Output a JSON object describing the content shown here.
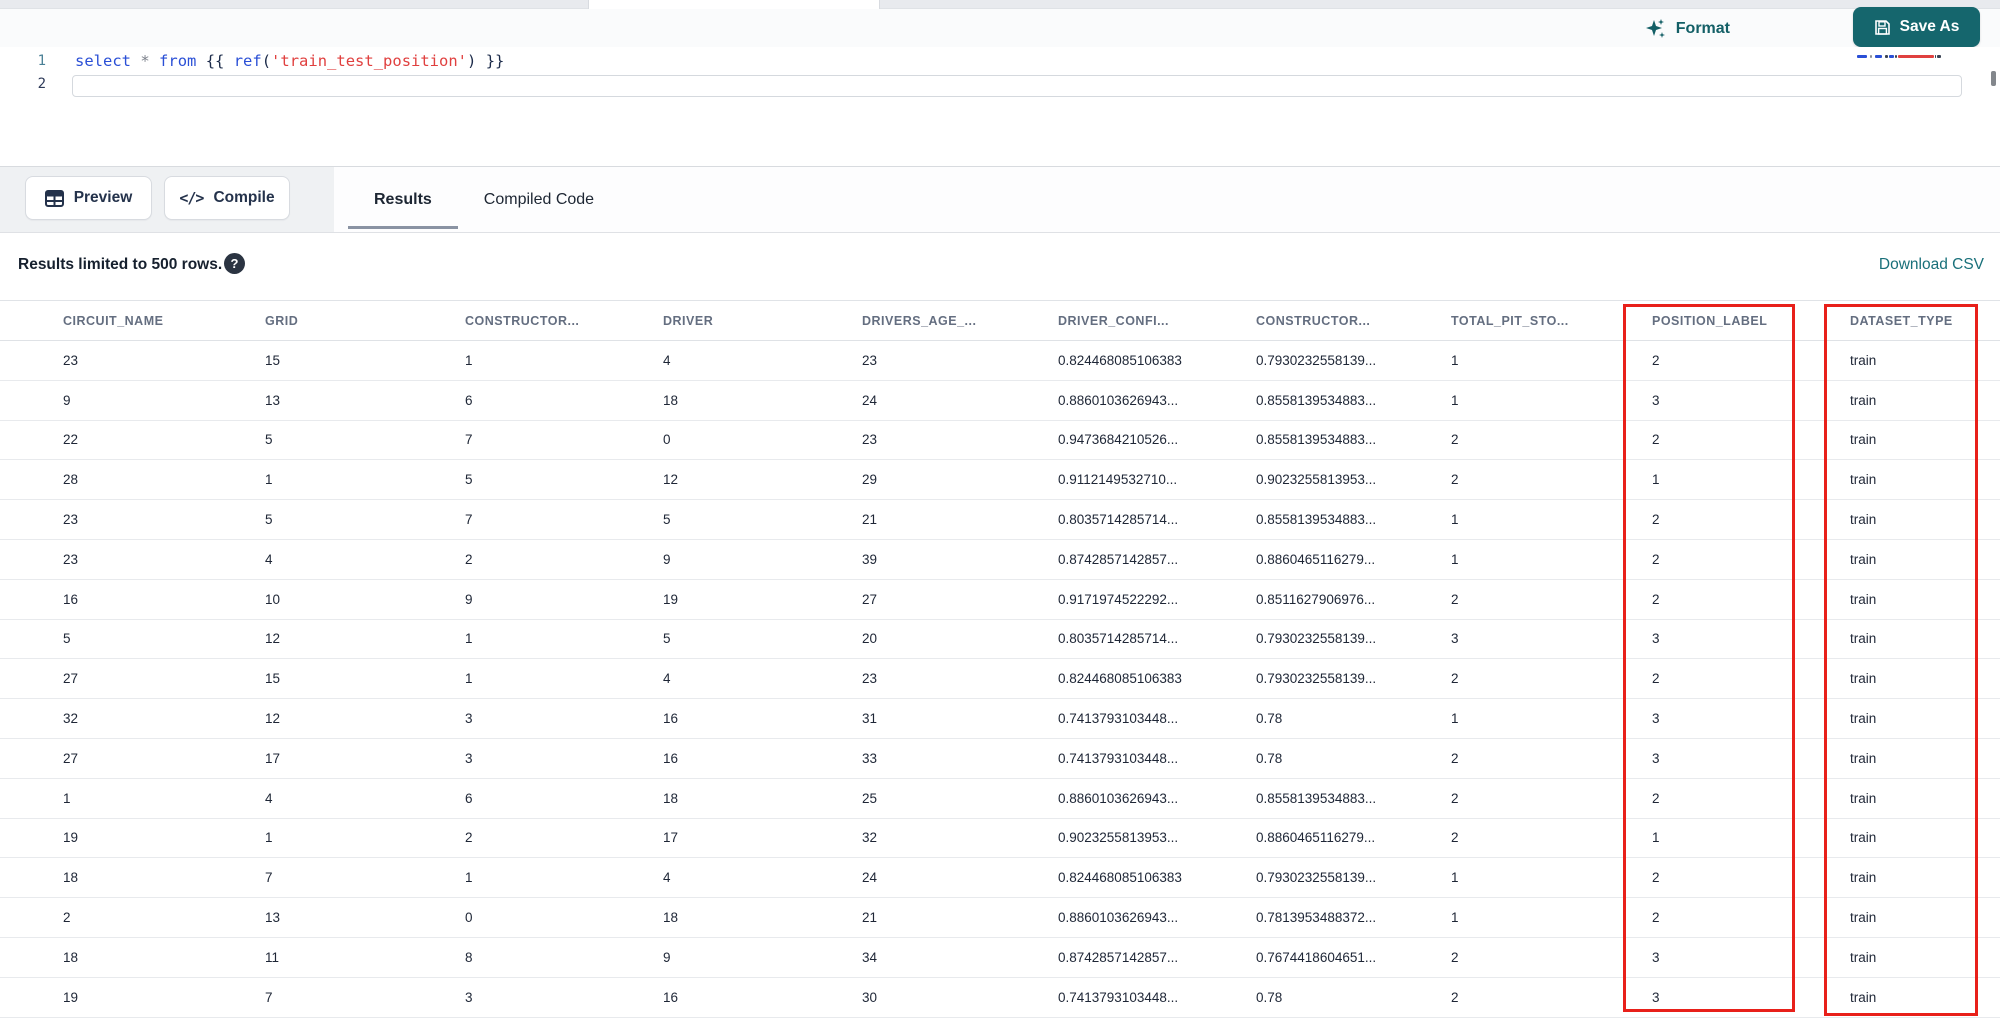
{
  "colors": {
    "accent_teal": "#15666d",
    "link_teal": "#19707a",
    "annotation_red": "#e8201a"
  },
  "toolbar": {
    "format_label": "Format",
    "save_as_label": "Save As"
  },
  "editor": {
    "line_numbers": [
      "1",
      "2"
    ],
    "code_tokens": [
      {
        "t": "select",
        "c": "kw"
      },
      {
        "t": " ",
        "c": "plain"
      },
      {
        "t": "*",
        "c": "op"
      },
      {
        "t": " ",
        "c": "plain"
      },
      {
        "t": "from",
        "c": "kw"
      },
      {
        "t": " ",
        "c": "plain"
      },
      {
        "t": "{{ ",
        "c": "punct"
      },
      {
        "t": "ref",
        "c": "kw"
      },
      {
        "t": "(",
        "c": "punct"
      },
      {
        "t": "'train_test_position'",
        "c": "str"
      },
      {
        "t": ")",
        "c": "punct"
      },
      {
        "t": " }}",
        "c": "punct"
      }
    ]
  },
  "actions": {
    "preview_label": "Preview",
    "compile_label": "Compile",
    "compile_glyph": "</>"
  },
  "tabs": [
    {
      "label": "Results",
      "active": true
    },
    {
      "label": "Compiled Code",
      "active": false
    }
  ],
  "results_bar": {
    "limit_text": "Results limited to 500 rows.",
    "help_glyph": "?",
    "download_label": "Download CSV"
  },
  "table": {
    "columns": [
      "CIRCUIT_NAME",
      "GRID",
      "CONSTRUCTOR...",
      "DRIVER",
      "DRIVERS_AGE_...",
      "DRIVER_CONFI...",
      "CONSTRUCTOR...",
      "TOTAL_PIT_STO...",
      "POSITION_LABEL",
      "DATASET_TYPE"
    ],
    "rows": [
      [
        "23",
        "15",
        "1",
        "4",
        "23",
        "0.824468085106383",
        "0.7930232558139...",
        "1",
        "2",
        "train"
      ],
      [
        "9",
        "13",
        "6",
        "18",
        "24",
        "0.8860103626943...",
        "0.8558139534883...",
        "1",
        "3",
        "train"
      ],
      [
        "22",
        "5",
        "7",
        "0",
        "23",
        "0.9473684210526...",
        "0.8558139534883...",
        "2",
        "2",
        "train"
      ],
      [
        "28",
        "1",
        "5",
        "12",
        "29",
        "0.9112149532710...",
        "0.9023255813953...",
        "2",
        "1",
        "train"
      ],
      [
        "23",
        "5",
        "7",
        "5",
        "21",
        "0.8035714285714...",
        "0.8558139534883...",
        "1",
        "2",
        "train"
      ],
      [
        "23",
        "4",
        "2",
        "9",
        "39",
        "0.8742857142857...",
        "0.8860465116279...",
        "1",
        "2",
        "train"
      ],
      [
        "16",
        "10",
        "9",
        "19",
        "27",
        "0.9171974522292...",
        "0.8511627906976...",
        "2",
        "2",
        "train"
      ],
      [
        "5",
        "12",
        "1",
        "5",
        "20",
        "0.8035714285714...",
        "0.7930232558139...",
        "3",
        "3",
        "train"
      ],
      [
        "27",
        "15",
        "1",
        "4",
        "23",
        "0.824468085106383",
        "0.7930232558139...",
        "2",
        "2",
        "train"
      ],
      [
        "32",
        "12",
        "3",
        "16",
        "31",
        "0.7413793103448...",
        "0.78",
        "1",
        "3",
        "train"
      ],
      [
        "27",
        "17",
        "3",
        "16",
        "33",
        "0.7413793103448...",
        "0.78",
        "2",
        "3",
        "train"
      ],
      [
        "1",
        "4",
        "6",
        "18",
        "25",
        "0.8860103626943...",
        "0.8558139534883...",
        "2",
        "2",
        "train"
      ],
      [
        "19",
        "1",
        "2",
        "17",
        "32",
        "0.9023255813953...",
        "0.8860465116279...",
        "2",
        "1",
        "train"
      ],
      [
        "18",
        "7",
        "1",
        "4",
        "24",
        "0.824468085106383",
        "0.7930232558139...",
        "1",
        "2",
        "train"
      ],
      [
        "2",
        "13",
        "0",
        "18",
        "21",
        "0.8860103626943...",
        "0.7813953488372...",
        "1",
        "2",
        "train"
      ],
      [
        "18",
        "11",
        "8",
        "9",
        "34",
        "0.8742857142857...",
        "0.7674418604651...",
        "2",
        "3",
        "train"
      ],
      [
        "19",
        "7",
        "3",
        "16",
        "30",
        "0.7413793103448...",
        "0.78",
        "2",
        "3",
        "train"
      ]
    ],
    "annotated_columns": [
      "POSITION_LABEL",
      "DATASET_TYPE"
    ]
  }
}
